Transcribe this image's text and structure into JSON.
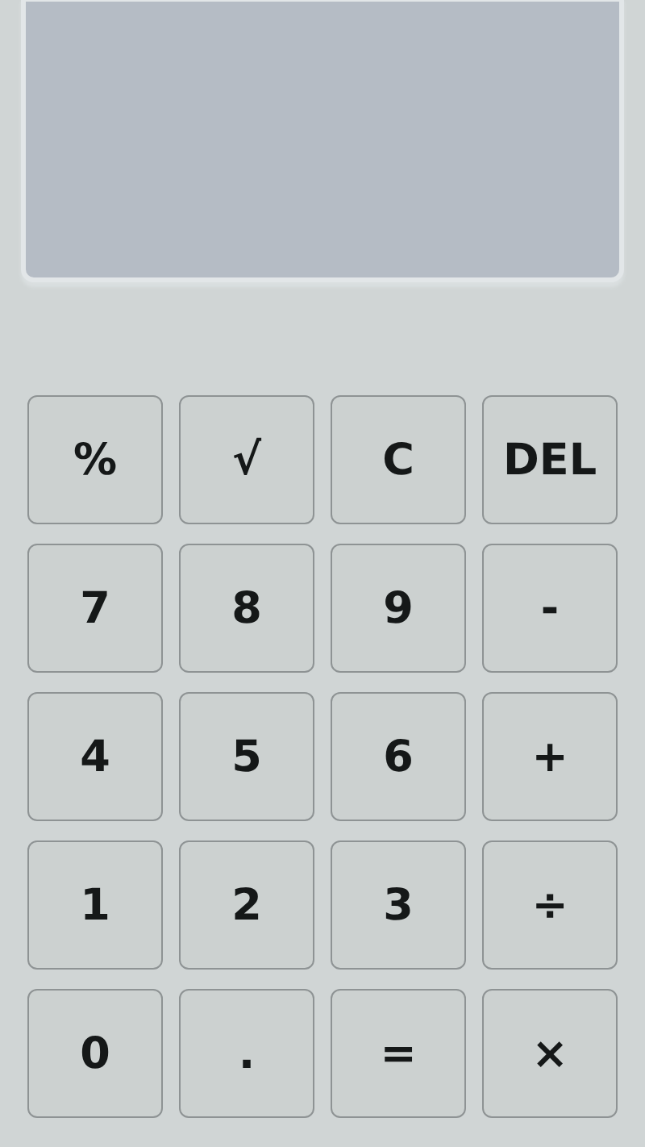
{
  "display": {
    "kind": "screen"
  },
  "keys": [
    {
      "label": "%"
    },
    {
      "label": "√"
    },
    {
      "label": "C"
    },
    {
      "label": "DEL"
    },
    {
      "label": "7"
    },
    {
      "label": "8"
    },
    {
      "label": "9"
    },
    {
      "label": "-"
    },
    {
      "label": "4"
    },
    {
      "label": "5"
    },
    {
      "label": "6"
    },
    {
      "label": "+"
    },
    {
      "label": "1"
    },
    {
      "label": "2"
    },
    {
      "label": "3"
    },
    {
      "label": "÷"
    },
    {
      "label": "0"
    },
    {
      "label": "."
    },
    {
      "label": "="
    },
    {
      "label": "×"
    }
  ]
}
